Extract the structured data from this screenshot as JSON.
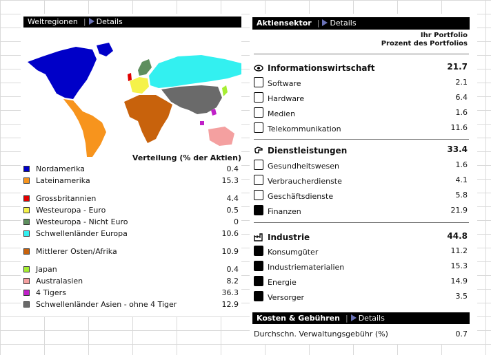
{
  "left": {
    "header": {
      "title": "Weltregionen",
      "details": "Details"
    },
    "value_header": "Verteilung (% der Aktien)",
    "regions": [
      {
        "name": "Nordamerika",
        "value": "0.4",
        "color": "#0000c8"
      },
      {
        "name": "Lateinamerika",
        "value": "15.3",
        "color": "#f7941d"
      },
      {
        "name": "Grossbritannien",
        "value": "4.4",
        "color": "#e00000"
      },
      {
        "name": "Westeuropa - Euro",
        "value": "0.5",
        "color": "#f5f24a"
      },
      {
        "name": "Westeuropa - Nicht Euro",
        "value": "0",
        "color": "#5e8f5e"
      },
      {
        "name": "Schwellenländer Europa",
        "value": "10.6",
        "color": "#33f0f0"
      },
      {
        "name": "Mittlerer Osten/Afrika",
        "value": "10.9",
        "color": "#c8620c"
      },
      {
        "name": "Japan",
        "value": "0.4",
        "color": "#a6ee33"
      },
      {
        "name": "Australasien",
        "value": "8.2",
        "color": "#f4a0a0"
      },
      {
        "name": "4 Tigers",
        "value": "36.3",
        "color": "#c020c8"
      },
      {
        "name": "Schwellenländer Asien - ohne 4 Tiger",
        "value": "12.9",
        "color": "#6a6a6a"
      }
    ]
  },
  "right": {
    "header": {
      "title": "Aktiensektor",
      "details": "Details"
    },
    "col_header_1": "Ihr Portfolio",
    "col_header_2": "Prozent des Portfolios",
    "groups": [
      {
        "name": "Informationswirtschaft",
        "value": "21.7",
        "icon": "eye-icon",
        "items": [
          {
            "name": "Software",
            "value": "2.1",
            "icon": "software-icon"
          },
          {
            "name": "Hardware",
            "value": "6.4",
            "icon": "hardware-icon"
          },
          {
            "name": "Medien",
            "value": "1.6",
            "icon": "media-icon"
          },
          {
            "name": "Telekommunikation",
            "value": "11.6",
            "icon": "phone-icon"
          }
        ]
      },
      {
        "name": "Dienstleistungen",
        "value": "33.4",
        "icon": "hand-icon",
        "items": [
          {
            "name": "Gesundheitswesen",
            "value": "1.6",
            "icon": "health-icon"
          },
          {
            "name": "Verbraucherdienste",
            "value": "4.1",
            "icon": "cart-icon"
          },
          {
            "name": "Geschäftsdienste",
            "value": "5.8",
            "icon": "business-icon"
          },
          {
            "name": "Finanzen",
            "value": "21.9",
            "icon": "dollar-icon"
          }
        ]
      },
      {
        "name": "Industrie",
        "value": "44.8",
        "icon": "factory-icon",
        "items": [
          {
            "name": "Konsumgüter",
            "value": "11.2",
            "icon": "car-icon"
          },
          {
            "name": "Industriematerialien",
            "value": "15.3",
            "icon": "gear-icon"
          },
          {
            "name": "Energie",
            "value": "14.9",
            "icon": "flame-icon"
          },
          {
            "name": "Versorger",
            "value": "3.5",
            "icon": "bulb-icon"
          }
        ]
      }
    ],
    "costs": {
      "title": "Kosten & Gebühren",
      "details": "Details",
      "row": {
        "label": "Durchschn. Verwaltungsgebühr (%)",
        "value": "0.7"
      }
    }
  }
}
